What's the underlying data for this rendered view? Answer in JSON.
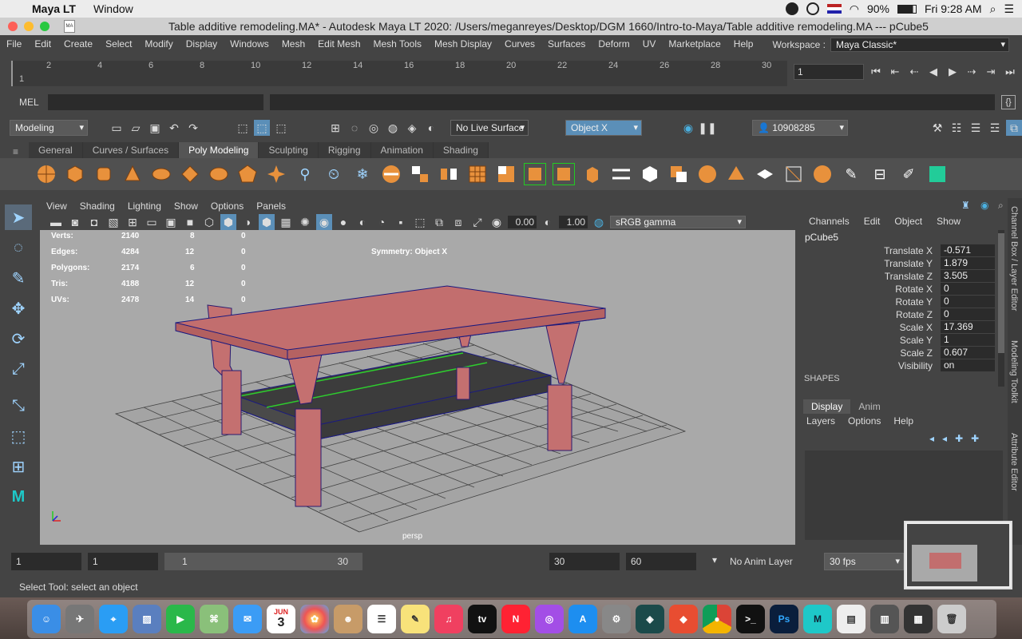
{
  "mac_menubar": {
    "app_name": "Maya LT",
    "menu": "Window",
    "battery": "90%",
    "clock": "Fri 9:28 AM"
  },
  "window": {
    "title": "Table additive remodeling.MA* - Autodesk Maya LT 2020: /Users/meganreyes/Desktop/DGM 1660/Intro-to-Maya/Table additive remodeling.MA  ---  pCube5"
  },
  "menu": {
    "items": [
      "File",
      "Edit",
      "Create",
      "Select",
      "Modify",
      "Display",
      "Windows",
      "Mesh",
      "Edit Mesh",
      "Mesh Tools",
      "Mesh Display",
      "Curves",
      "Surfaces",
      "Deform",
      "UV",
      "Marketplace",
      "Help"
    ],
    "workspace_label": "Workspace :",
    "workspace_value": "Maya Classic*"
  },
  "timeline": {
    "ticks": [
      "2",
      "4",
      "6",
      "8",
      "10",
      "12",
      "14",
      "16",
      "18",
      "20",
      "22",
      "24",
      "26",
      "28",
      "30"
    ],
    "start_label": "1",
    "current_frame": "1"
  },
  "mel": {
    "label": "MEL"
  },
  "statusline": {
    "mode": "Modeling",
    "live_surface": "No Live Surface",
    "symmetry": "Object X",
    "user_id": "10908285"
  },
  "shelf_tabs": [
    "General",
    "Curves / Surfaces",
    "Poly Modeling",
    "Sculpting",
    "Rigging",
    "Animation",
    "Shading"
  ],
  "viewport": {
    "menu": [
      "View",
      "Shading",
      "Lighting",
      "Show",
      "Options",
      "Panels"
    ],
    "exposure": "0.00",
    "gamma": "1.00",
    "colorspace": "sRGB gamma",
    "symmetry_hud": "Symmetry: Object X",
    "camera": "persp",
    "hud_stats": [
      {
        "label": "Verts:",
        "a": "2140",
        "b": "8",
        "c": "0"
      },
      {
        "label": "Edges:",
        "a": "4284",
        "b": "12",
        "c": "0"
      },
      {
        "label": "Polygons:",
        "a": "2174",
        "b": "6",
        "c": "0"
      },
      {
        "label": "Tris:",
        "a": "4188",
        "b": "12",
        "c": "0"
      },
      {
        "label": "UVs:",
        "a": "2478",
        "b": "14",
        "c": "0"
      }
    ]
  },
  "channel_box": {
    "menu": [
      "Channels",
      "Edit",
      "Object",
      "Show"
    ],
    "object": "pCube5",
    "channels": [
      {
        "label": "Translate X",
        "value": "-0.571"
      },
      {
        "label": "Translate Y",
        "value": "1.879"
      },
      {
        "label": "Translate Z",
        "value": "3.505"
      },
      {
        "label": "Rotate X",
        "value": "0"
      },
      {
        "label": "Rotate Y",
        "value": "0"
      },
      {
        "label": "Rotate Z",
        "value": "0"
      },
      {
        "label": "Scale X",
        "value": "17.369"
      },
      {
        "label": "Scale Y",
        "value": "1"
      },
      {
        "label": "Scale Z",
        "value": "0.607"
      },
      {
        "label": "Visibility",
        "value": "on"
      }
    ],
    "shapes_header": "SHAPES"
  },
  "layer_editor": {
    "tabs": [
      "Display",
      "Anim"
    ],
    "menu": [
      "Layers",
      "Options",
      "Help"
    ]
  },
  "side_tabs": [
    "Channel Box / Layer Editor",
    "Modeling Toolkit",
    "Attribute Editor"
  ],
  "range": {
    "start": "1",
    "playback_start": "1",
    "slider_start": "1",
    "slider_end": "30",
    "playback_end": "30",
    "end": "60",
    "anim_layer": "No Anim Layer",
    "fps": "30 fps"
  },
  "help_line": "Select Tool: select an object",
  "dock": {
    "calendar_month": "JUN",
    "calendar_day": "3"
  }
}
